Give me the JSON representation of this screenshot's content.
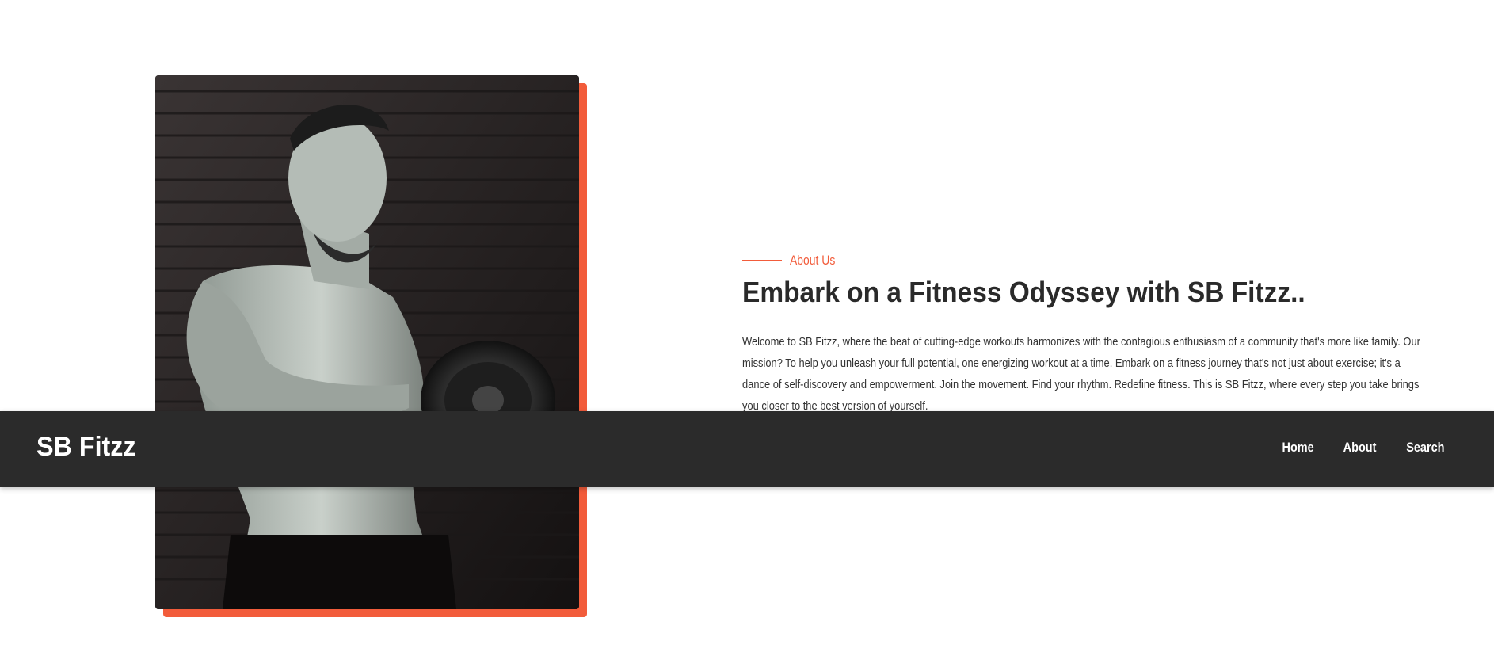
{
  "about": {
    "eyebrow": "About Us",
    "heading": "Embark on a Fitness Odyssey with SB Fitzz..",
    "body": "Welcome to SB Fitzz, where the beat of cutting-edge workouts harmonizes with the contagious enthusiasm of a community that's more like family. Our mission? To help you unleash your full potential, one energizing workout at a time. Embark on a fitness journey that's not just about exercise; it's a dance of self-discovery and empowerment. Join the movement. Find your rhythm. Redefine fitness. This is SB Fitzz, where every step you take brings you closer to the best version of yourself."
  },
  "navbar": {
    "brand": "SB Fitzz",
    "links": [
      "Home",
      "About",
      "Search"
    ]
  },
  "colors": {
    "accent": "#f25c3b",
    "navbar_bg": "#2b2b2b",
    "text": "#2a2a2a"
  },
  "image": {
    "subject": "bodybuilder-curling-dumbbell-photo"
  }
}
